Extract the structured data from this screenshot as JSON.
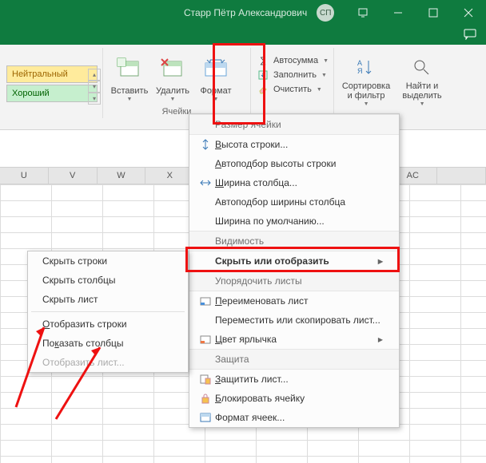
{
  "title": "Старр Пётр Александрович",
  "avatar": "СП",
  "styles": {
    "neutral": "Нейтральный",
    "good": "Хороший"
  },
  "ribbon": {
    "insert": "Вставить",
    "delete": "Удалить",
    "format": "Формат",
    "cells_caption": "Ячейки",
    "autosum": "Автосумма",
    "fill": "Заполнить",
    "clear": "Очистить",
    "sort_filter_l1": "Сортировка",
    "sort_filter_l2": "и фильтр",
    "find_l1": "Найти и",
    "find_l2": "выделить"
  },
  "columns": [
    "U",
    "V",
    "W",
    "X",
    "",
    "",
    "",
    "",
    "AC"
  ],
  "format_menu": {
    "hdr_size": "Размер ячейки",
    "row_height": "Высота строки...",
    "autofit_row": "Автоподбор высоты строки",
    "col_width": "Ширина столбца...",
    "autofit_col": "Автоподбор ширины столбца",
    "default_width": "Ширина по умолчанию...",
    "hdr_vis": "Видимость",
    "hide_show": "Скрыть или отобразить",
    "hdr_sheets": "Упорядочить листы",
    "rename": "Переименовать лист",
    "move_copy": "Переместить или скопировать лист...",
    "tab_color": "Цвет ярлычка",
    "hdr_protect": "Защита",
    "protect_sheet": "Защитить лист...",
    "lock_cell": "Блокировать ячейку",
    "cell_format": "Формат ячеек..."
  },
  "submenu": {
    "hide_rows": "Скрыть строки",
    "hide_cols": "Скрыть столбцы",
    "hide_sheet": "Скрыть лист",
    "show_rows": "тобразить строки",
    "show_rows_u": "О",
    "show_cols": "азать столбцы",
    "show_cols_u": "к",
    "show_cols_pre": "По",
    "show_sheet": "Отобразить лист..."
  }
}
